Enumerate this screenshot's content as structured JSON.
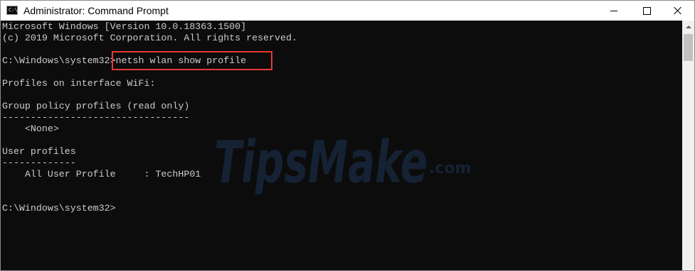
{
  "window": {
    "title": "Administrator: Command Prompt",
    "icon_label": "C:\\"
  },
  "console": {
    "lines": [
      "Microsoft Windows [Version 10.0.18363.1500]",
      "(c) 2019 Microsoft Corporation. All rights reserved.",
      "",
      "C:\\Windows\\system32>netsh wlan show profile",
      "",
      "Profiles on interface WiFi:",
      "",
      "Group policy profiles (read only)",
      "---------------------------------",
      "    <None>",
      "",
      "User profiles",
      "-------------",
      "    All User Profile     : TechHP01",
      "",
      "",
      "C:\\Windows\\system32>"
    ]
  },
  "watermark": {
    "text": "TipsMake",
    "suffix": ".com"
  },
  "colors": {
    "console_bg": "#0c0c0c",
    "console_text": "#cccccc",
    "highlight_border": "#e53935",
    "watermark": "#1e3556"
  }
}
